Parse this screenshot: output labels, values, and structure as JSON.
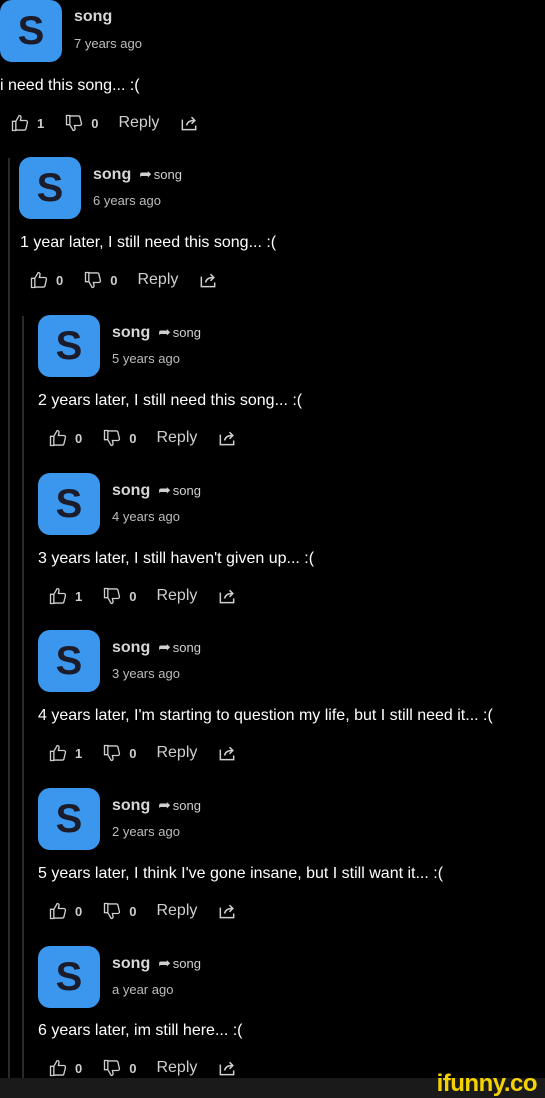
{
  "comments": [
    {
      "avatar_letter": "S",
      "author": "song",
      "reply_to": "",
      "time": "7 years ago",
      "text": "i need this song... :(",
      "likes": "1",
      "dislikes": "0",
      "reply_label": "Reply"
    },
    {
      "avatar_letter": "S",
      "author": "song",
      "reply_to": "song",
      "time": "6 years ago",
      "text": "1 year later, I still need this song... :(",
      "likes": "0",
      "dislikes": "0",
      "reply_label": "Reply"
    },
    {
      "avatar_letter": "S",
      "author": "song",
      "reply_to": "song",
      "time": "5 years ago",
      "text": "2 years later, I still need this song... :(",
      "likes": "0",
      "dislikes": "0",
      "reply_label": "Reply"
    },
    {
      "avatar_letter": "S",
      "author": "song",
      "reply_to": "song",
      "time": "4 years ago",
      "text": "3 years later, I still haven't given up... :(",
      "likes": "1",
      "dislikes": "0",
      "reply_label": "Reply"
    },
    {
      "avatar_letter": "S",
      "author": "song",
      "reply_to": "song",
      "time": "3 years ago",
      "text": "4 years later, I'm starting to question my life, but I still need it... :(",
      "likes": "1",
      "dislikes": "0",
      "reply_label": "Reply"
    },
    {
      "avatar_letter": "S",
      "author": "song",
      "reply_to": "song",
      "time": "2 years ago",
      "text": "5 years later, I think I've gone insane, but I still want it... :(",
      "likes": "0",
      "dislikes": "0",
      "reply_label": "Reply"
    },
    {
      "avatar_letter": "S",
      "author": "song",
      "reply_to": "song",
      "time": "a year ago",
      "text": "6 years later, im still here... :(",
      "likes": "0",
      "dislikes": "0",
      "reply_label": "Reply"
    }
  ],
  "watermark": "ifunny.co",
  "colors": {
    "avatar": "#3b97ee",
    "background": "#000000",
    "watermark": "#f5d200"
  }
}
